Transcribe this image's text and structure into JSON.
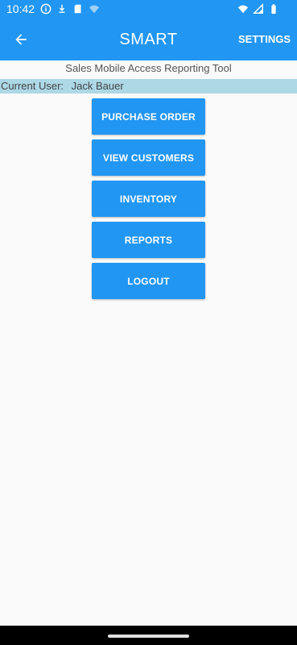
{
  "status_bar": {
    "time": "10:42",
    "left_icons": [
      "info-icon",
      "download-icon",
      "sd-card-icon",
      "wifi-icon"
    ],
    "right_icons": [
      "wifi-icon",
      "signal-icon",
      "battery-icon"
    ]
  },
  "app_bar": {
    "back_icon": "arrow-back-icon",
    "title": "SMART",
    "settings_label": "SETTINGS",
    "color": "#2196f3"
  },
  "subtitle": "Sales Mobile Access Reporting Tool",
  "current_user": {
    "label": "Current User:",
    "name": "Jack Bauer",
    "row_color": "#add8e6"
  },
  "menu": {
    "items": [
      {
        "label": "PURCHASE ORDER"
      },
      {
        "label": "VIEW CUSTOMERS"
      },
      {
        "label": "INVENTORY"
      },
      {
        "label": "REPORTS"
      },
      {
        "label": "LOGOUT"
      }
    ],
    "button_color": "#2196f3"
  }
}
